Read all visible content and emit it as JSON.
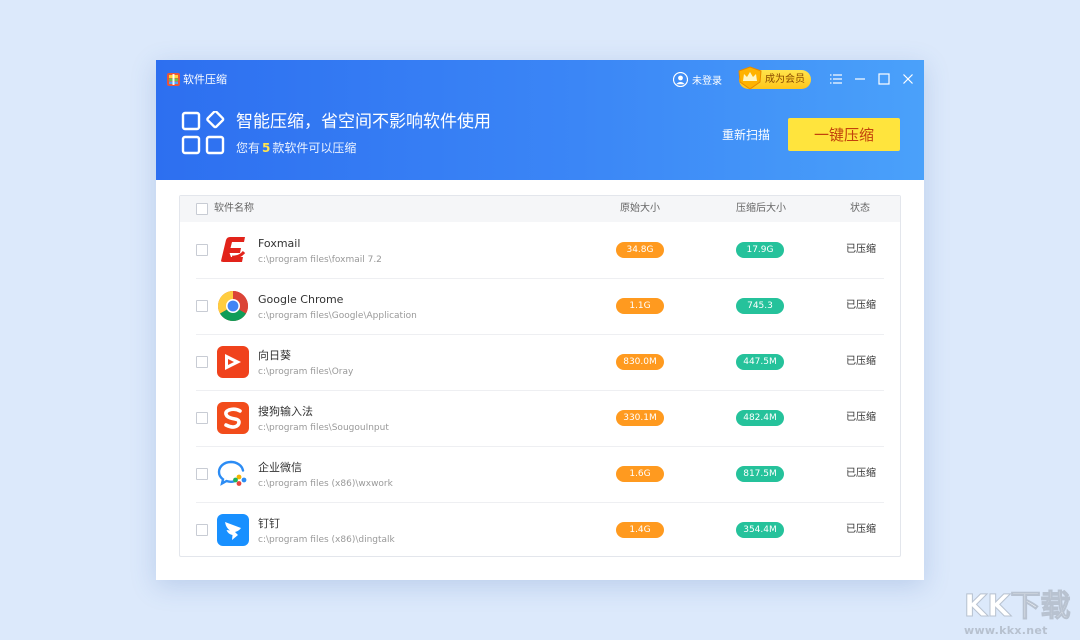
{
  "app": {
    "title": "软件压缩"
  },
  "header": {
    "login_label": "未登录",
    "vip_label": "成为会员",
    "headline": "智能压缩，省空间不影响软件使用",
    "sub_prefix": "您有",
    "sub_count": "5",
    "sub_suffix": "款软件可以压缩",
    "rescan_label": "重新扫描",
    "compress_label": "一键压缩"
  },
  "table": {
    "columns": {
      "name": "软件名称",
      "original": "原始大小",
      "compressed": "压缩后大小",
      "status": "状态"
    },
    "rows": [
      {
        "name": "Foxmail",
        "path": "c:\\program files\\foxmail 7.2",
        "original": "34.8G",
        "compressed": "17.9G",
        "status": "已压缩",
        "icon": "foxmail-icon"
      },
      {
        "name": "Google Chrome",
        "path": "c:\\program files\\Google\\Application",
        "original": "1.1G",
        "compressed": "745.3",
        "status": "已压缩",
        "icon": "chrome-icon"
      },
      {
        "name": "向日葵",
        "path": "c:\\program files\\Oray",
        "original": "830.0M",
        "compressed": "447.5M",
        "status": "已压缩",
        "icon": "sunlogin-icon"
      },
      {
        "name": "搜狗输入法",
        "path": "c:\\program files\\SougouInput",
        "original": "330.1M",
        "compressed": "482.4M",
        "status": "已压缩",
        "icon": "sogou-icon"
      },
      {
        "name": "企业微信",
        "path": "c:\\program files (x86)\\wxwork",
        "original": "1.6G",
        "compressed": "817.5M",
        "status": "已压缩",
        "icon": "wxwork-icon"
      },
      {
        "name": "钉钉",
        "path": "c:\\program files (x86)\\dingtalk",
        "original": "1.4G",
        "compressed": "354.4M",
        "status": "已压缩",
        "icon": "dingtalk-icon"
      }
    ]
  },
  "watermark": {
    "text": "KK下载",
    "url": "www.kkx.net"
  },
  "colors": {
    "header_start": "#2d6ff0",
    "header_end": "#4aa1fa",
    "accent_yellow": "#ffe43d",
    "orig_pill": "#ff9a1f",
    "comp_pill": "#25c29b"
  }
}
